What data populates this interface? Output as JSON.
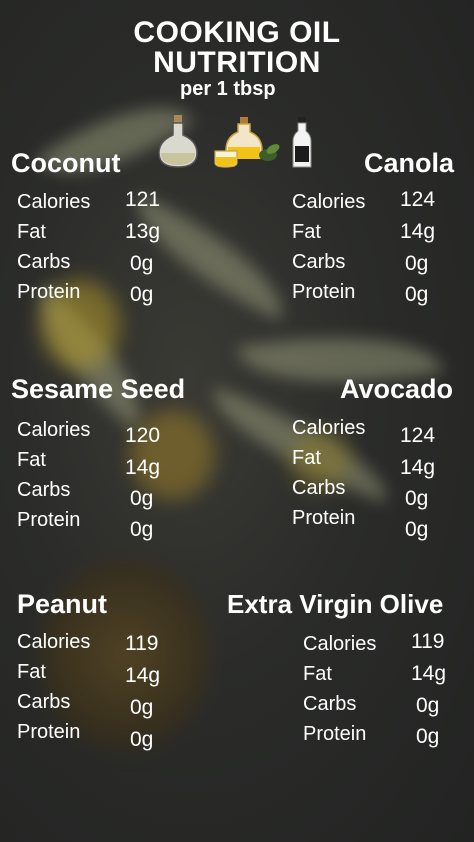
{
  "title_line1": "COOKING OIL",
  "title_line2": "NUTRITION",
  "subtitle": "per 1 tbsp",
  "icons": [
    "oil-bottle-icon",
    "oil-jars-icon",
    "oil-bottle-slim-icon"
  ],
  "colors": {
    "text": "#ffffff",
    "background": "#2a2b29"
  },
  "oils": [
    {
      "name": "Coconut",
      "rows": [
        {
          "label": "Calories",
          "value": "121"
        },
        {
          "label": "Fat",
          "value": "13g"
        },
        {
          "label": "Carbs",
          "value": "0g"
        },
        {
          "label": "Protein",
          "value": "0g"
        }
      ]
    },
    {
      "name": "Canola",
      "rows": [
        {
          "label": "Calories",
          "value": "124"
        },
        {
          "label": "Fat",
          "value": "14g"
        },
        {
          "label": "Carbs",
          "value": "0g"
        },
        {
          "label": "Protein",
          "value": "0g"
        }
      ]
    },
    {
      "name": "Sesame Seed",
      "rows": [
        {
          "label": "Calories",
          "value": "120"
        },
        {
          "label": "Fat",
          "value": "14g"
        },
        {
          "label": "Carbs",
          "value": "0g"
        },
        {
          "label": "Protein",
          "value": "0g"
        }
      ]
    },
    {
      "name": "Avocado",
      "rows": [
        {
          "label": "Calories",
          "value": "124"
        },
        {
          "label": "Fat",
          "value": "14g"
        },
        {
          "label": "Carbs",
          "value": "0g"
        },
        {
          "label": "Protein",
          "value": "0g"
        }
      ]
    },
    {
      "name": "Peanut",
      "rows": [
        {
          "label": "Calories",
          "value": "119"
        },
        {
          "label": "Fat",
          "value": "14g"
        },
        {
          "label": "Carbs",
          "value": "0g"
        },
        {
          "label": "Protein",
          "value": "0g"
        }
      ]
    },
    {
      "name": "Extra Virgin Olive",
      "rows": [
        {
          "label": "Calories",
          "value": "119"
        },
        {
          "label": "Fat",
          "value": "14g"
        },
        {
          "label": "Carbs",
          "value": "0g"
        },
        {
          "label": "Protein",
          "value": "0g"
        }
      ]
    }
  ]
}
